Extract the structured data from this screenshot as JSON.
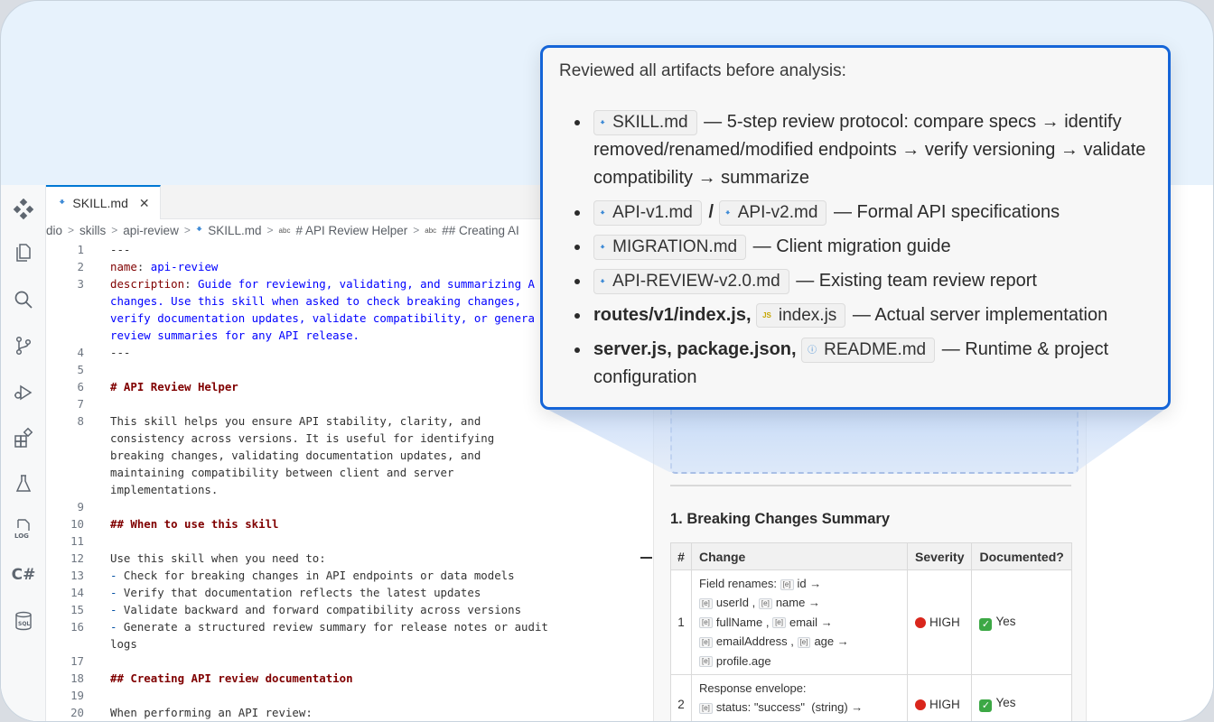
{
  "editor": {
    "tab_label": "SKILL.md",
    "breadcrumb": [
      "dio",
      "skills",
      "api-review",
      "SKILL.md",
      "# API Review Helper",
      "## Creating AI"
    ],
    "lines": [
      {
        "n": "1",
        "t": "---"
      },
      {
        "n": "2",
        "key": "name",
        "sep": ": ",
        "val": "api-review"
      },
      {
        "n": "3",
        "key": "description",
        "sep": ": ",
        "val": "Guide for reviewing, validating, and summarizing A"
      },
      {
        "n": "",
        "val": "changes. Use this skill when asked to check breaking changes,"
      },
      {
        "n": "",
        "val": "verify documentation updates, validate compatibility, or genera"
      },
      {
        "n": "",
        "val": "review summaries for any API release."
      },
      {
        "n": "4",
        "t": "---"
      },
      {
        "n": "5",
        "t": ""
      },
      {
        "n": "6",
        "head": "# API Review Helper"
      },
      {
        "n": "7",
        "t": ""
      },
      {
        "n": "8",
        "t": "This skill helps you ensure API stability, clarity, and"
      },
      {
        "n": "",
        "t": "consistency across versions. It is useful for identifying"
      },
      {
        "n": "",
        "t": "breaking changes, validating documentation updates, and"
      },
      {
        "n": "",
        "t": "maintaining compatibility between client and server"
      },
      {
        "n": "",
        "t": "implementations."
      },
      {
        "n": "9",
        "t": ""
      },
      {
        "n": "10",
        "head": "## When to use this skill"
      },
      {
        "n": "11",
        "t": ""
      },
      {
        "n": "12",
        "t": "Use this skill when you need to:"
      },
      {
        "n": "13",
        "dash": "-",
        "t": " Check for breaking changes in API endpoints or data models"
      },
      {
        "n": "14",
        "dash": "-",
        "t": " Verify that documentation reflects the latest updates"
      },
      {
        "n": "15",
        "dash": "-",
        "t": " Validate backward and forward compatibility across versions"
      },
      {
        "n": "16",
        "dash": "-",
        "t": " Generate a structured review summary for release notes or audit"
      },
      {
        "n": "",
        "t": "logs"
      },
      {
        "n": "17",
        "t": ""
      },
      {
        "n": "18",
        "head": "## Creating API review documentation"
      },
      {
        "n": "19",
        "t": ""
      },
      {
        "n": "20",
        "t": "When performing an API review:"
      }
    ]
  },
  "activity_bar": {
    "log_label": "LOG",
    "csharp_label": "C#",
    "sql_label": "SQL"
  },
  "review": {
    "section_title": "1. Breaking Changes Summary",
    "headers": [
      "#",
      "Change",
      "Severity",
      "Documented?"
    ],
    "row1": {
      "num": "1",
      "lead": "Field renames:",
      "tokens": [
        "id",
        "userId",
        "name",
        "fullName",
        "email",
        "emailAddress",
        "age",
        "profile.age"
      ],
      "arrow": "→",
      "comma": ",",
      "severity": "HIGH",
      "documented": "Yes"
    },
    "row2": {
      "num": "2",
      "lead": "Response envelope:",
      "token": "status: \"success\"",
      "type_note": "(string) →",
      "severity": "HIGH",
      "documented": "Yes"
    }
  },
  "callout": {
    "title": "Reviewed all artifacts before analysis:",
    "items": [
      {
        "chip": "SKILL.md",
        "text": "— 5-step review protocol: compare specs → identify removed/renamed/modified endpoints → verify versioning → validate compatibility → summarize"
      },
      {
        "chip_a": "API-v1.md",
        "slash": "/",
        "chip_b": "API-v2.md",
        "text": "— Formal API specifications"
      },
      {
        "chip": "MIGRATION.md",
        "text": "— Client migration guide"
      },
      {
        "chip": "API-REVIEW-v2.0.md",
        "text": "— Existing team review report"
      },
      {
        "bold": "routes/v1/index.js,",
        "chip": "index.js",
        "text": "— Actual server implementation"
      },
      {
        "bold": "server.js, package.json,",
        "chip": "README.md",
        "text": "— Runtime & project configuration"
      }
    ]
  },
  "colors": {
    "accent": "#1565d8",
    "tab_accent": "#0078d4",
    "severity_high": "#d9261c",
    "documented_yes": "#3ca845"
  },
  "icons": [
    "copilot-icon",
    "explorer-icon",
    "search-icon",
    "source-control-icon",
    "run-debug-icon",
    "extensions-icon",
    "testing-icon",
    "log-icon",
    "csharp-icon",
    "database-icon",
    "markdown-file-icon",
    "close-icon",
    "javascript-file-icon",
    "info-file-icon",
    "symbol-field-icon"
  ]
}
